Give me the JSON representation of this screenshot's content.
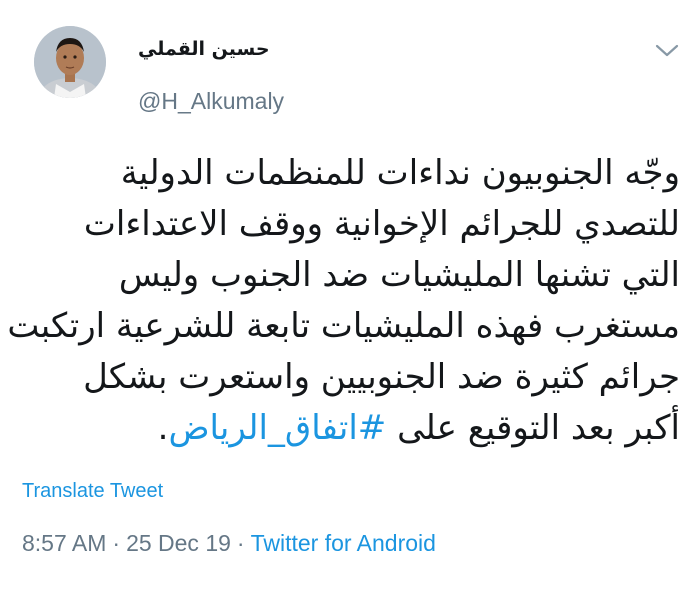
{
  "author": {
    "display_name": "حسين القملي",
    "handle": "@H_Alkumaly"
  },
  "tweet": {
    "lines": [
      "وجّه الجنوبيون نداءات للمنظمات الدولية",
      "للتصدي للجرائم الإخوانية ووقف الاعتداءات",
      "التي تشنها المليشيات ضد الجنوب وليس",
      "مستغرب فهذه المليشيات تابعة للشرعية ارتكبت",
      "جرائم كثيرة ضد الجنوبيين واستعرت بشكل"
    ],
    "last_line_text": "أكبر بعد التوقيع على ",
    "hashtag": "#اتفاق_الرياض",
    "trailing_punct": "."
  },
  "actions": {
    "translate_label": "Translate Tweet"
  },
  "meta": {
    "time": "8:57 AM",
    "separator": "·",
    "date": "25 Dec 19",
    "source": "Twitter for Android"
  },
  "icons": {
    "menu": "chevron-down-icon"
  },
  "colors": {
    "link": "#1b95e0",
    "secondary_text": "#657786",
    "primary_text": "#14171a"
  }
}
